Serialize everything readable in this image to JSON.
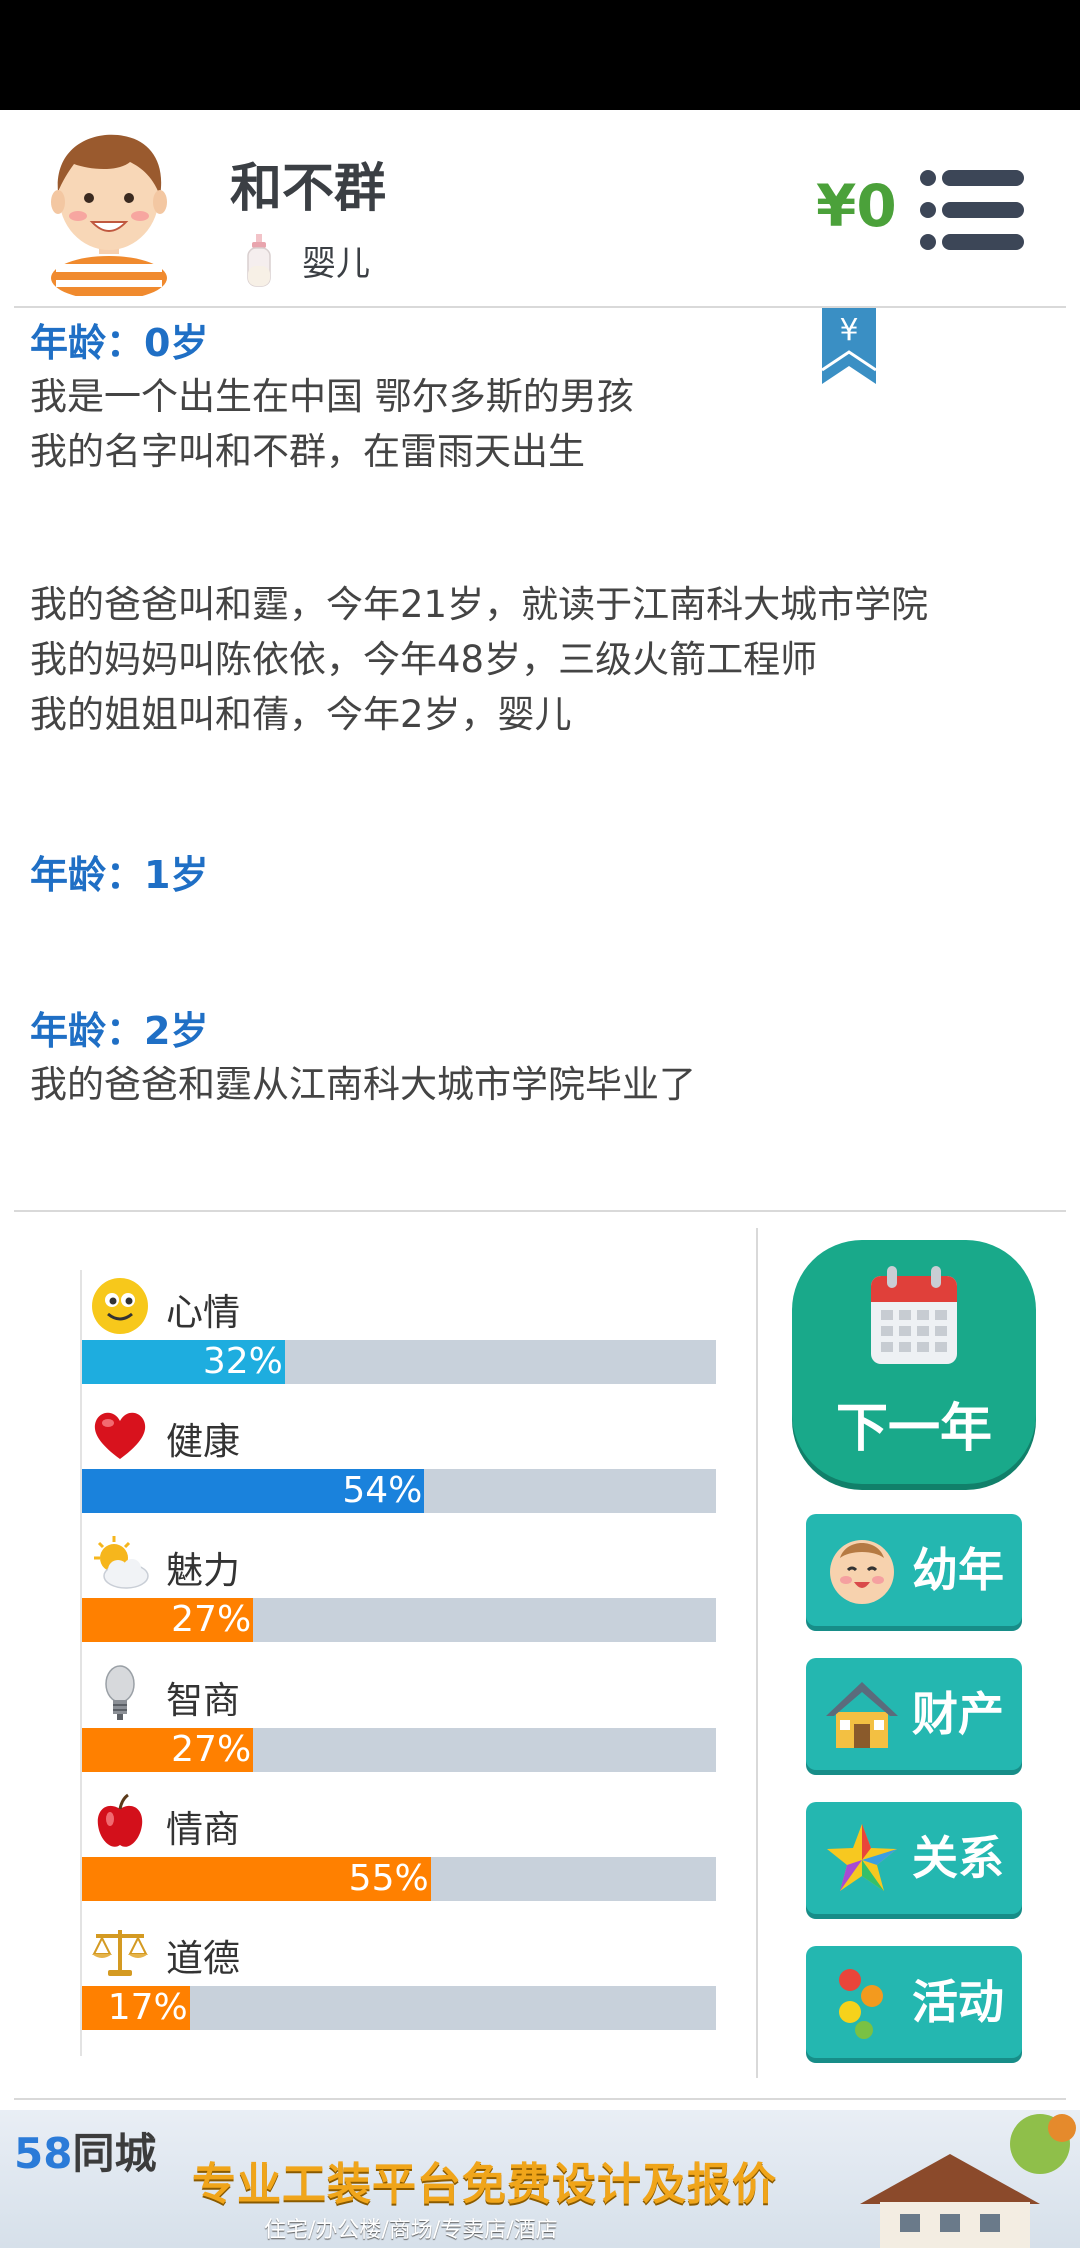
{
  "header": {
    "name": "和不群",
    "stage": "婴儿",
    "money": "¥0"
  },
  "log": {
    "entries": [
      {
        "age": "年龄：0岁"
      },
      {
        "text": "我是一个出生在中国 鄂尔多斯的男孩"
      },
      {
        "text": "我的名字叫和不群，在雷雨天出生"
      },
      {
        "text": "我的爸爸叫和霆，今年21岁，就读于江南科大城市学院"
      },
      {
        "text": "我的妈妈叫陈依依，今年48岁，三级火箭工程师"
      },
      {
        "text": "我的姐姐叫和蒨，今年2岁，婴儿"
      },
      {
        "age": "年龄：1岁"
      },
      {
        "age": "年龄：2岁"
      },
      {
        "text": "我的爸爸和霆从江南科大城市学院毕业了"
      }
    ],
    "bookmark_symbol": "¥"
  },
  "attributes": [
    {
      "name": "心情",
      "value": 32,
      "label": "32%",
      "color": "#1eaddf",
      "icon": "smiley-icon"
    },
    {
      "name": "健康",
      "value": 54,
      "label": "54%",
      "color": "#1a82dc",
      "icon": "heart-icon"
    },
    {
      "name": "魅力",
      "value": 27,
      "label": "27%",
      "color": "#ff8000",
      "icon": "sun-cloud-icon"
    },
    {
      "name": "智商",
      "value": 27,
      "label": "27%",
      "color": "#ff8000",
      "icon": "lightbulb-icon"
    },
    {
      "name": "情商",
      "value": 55,
      "label": "55%",
      "color": "#ff8000",
      "icon": "apple-icon"
    },
    {
      "name": "道德",
      "value": 17,
      "label": "17%",
      "color": "#ff8000",
      "icon": "scales-icon"
    }
  ],
  "actions": {
    "next_year": "下一年",
    "childhood": "幼年",
    "property": "财产",
    "relations": "关系",
    "activities": "活动"
  },
  "ad": {
    "brand_num": "58",
    "brand_text": "同城",
    "title": "专业工装平台免费设计及报价",
    "subtitle": "住宅/办公楼/商场/专卖店/酒店"
  }
}
